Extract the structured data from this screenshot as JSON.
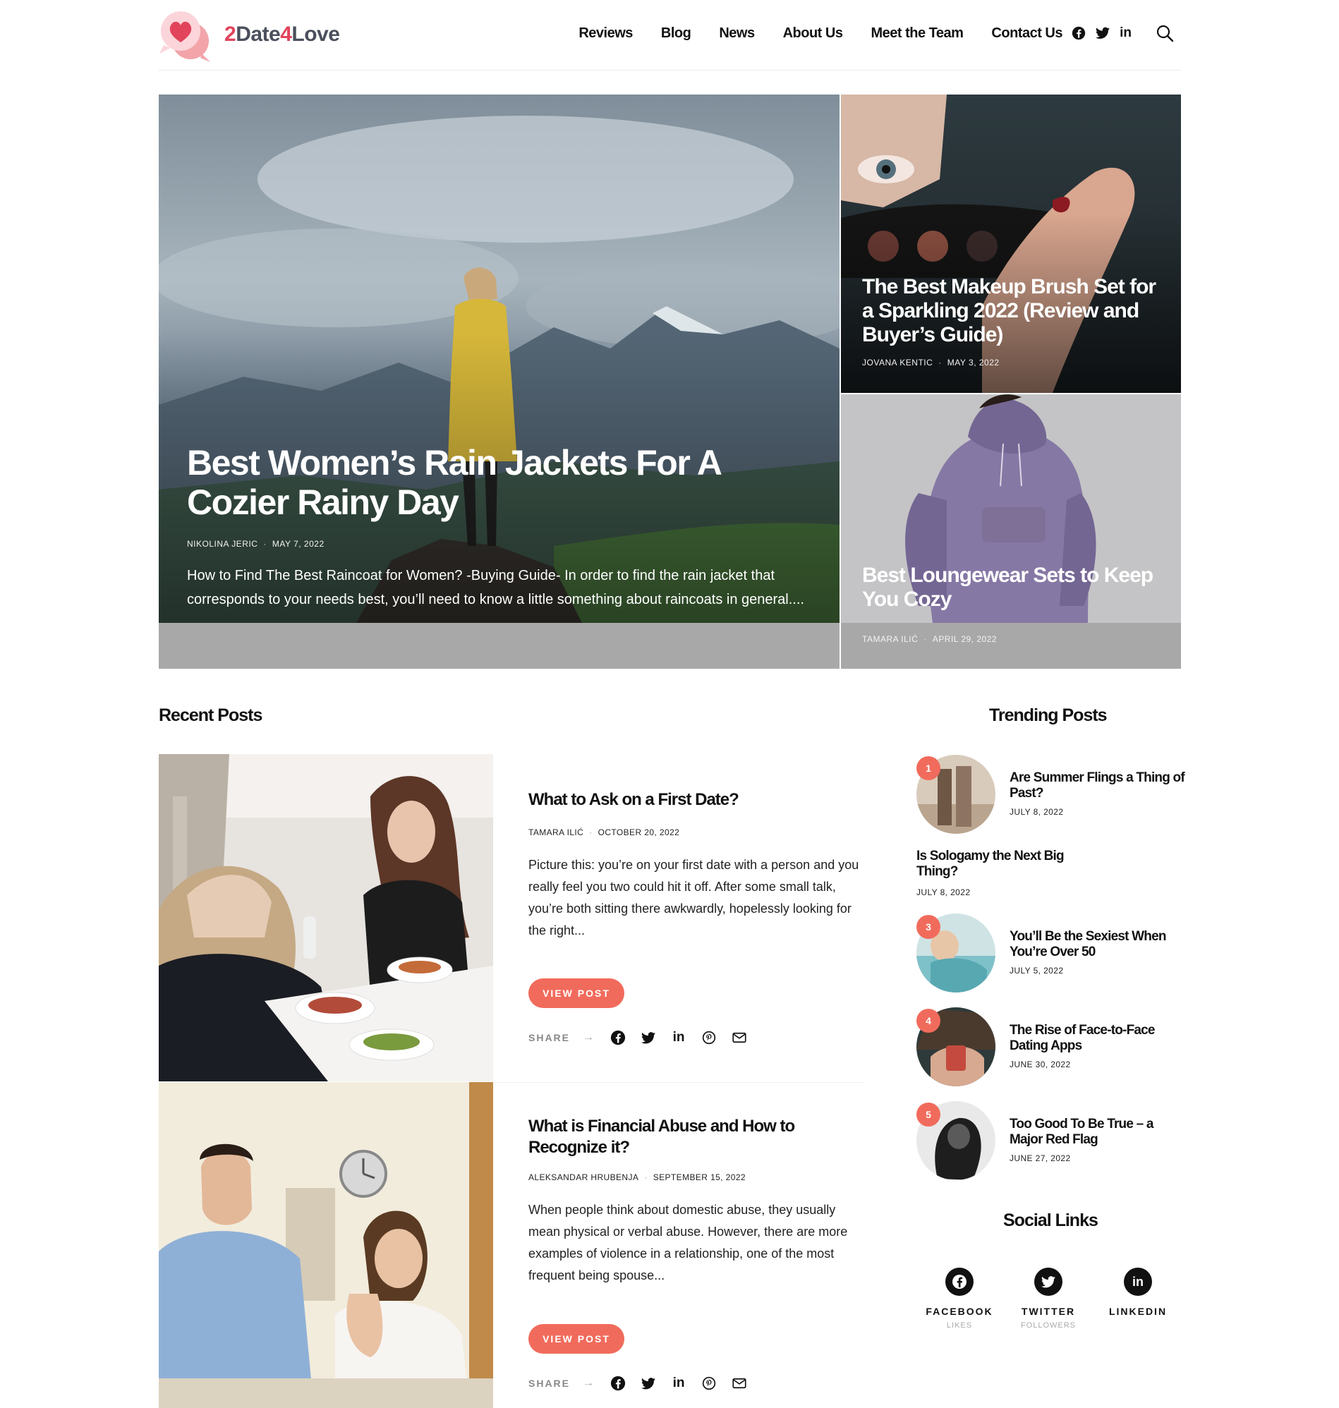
{
  "brand": {
    "part1": "2",
    "part2": "Date",
    "part3": "4",
    "part4": "Love",
    "color_primary": "#e2445c",
    "color_secondary": "#4b4f5c"
  },
  "nav": {
    "items": [
      "Reviews",
      "Blog",
      "News",
      "About Us",
      "Meet the Team",
      "Contact Us"
    ],
    "social_icons": [
      "facebook-icon",
      "twitter-icon",
      "linkedin-icon"
    ],
    "search_icon": "search-icon"
  },
  "hero": {
    "main": {
      "title": "Best Women’s Rain Jackets For A Cozier Rainy Day",
      "author": "NIKOLINA JERIC",
      "date": "MAY 7, 2022",
      "excerpt": "How to Find The Best Raincoat for Women? -Buying Guide- In order to find the rain jacket that corresponds to your needs best, you’ll need to know a little something about raincoats in general...."
    },
    "right_top": {
      "title": "The Best Makeup Brush Set for a Sparkling 2022 (Review and Buyer’s Guide)",
      "author": "JOVANA KENTIC",
      "date": "MAY 3, 2022"
    },
    "right_bottom": {
      "title": "Best Loungewear Sets to Keep You Cozy",
      "author": "TAMARA ILIĆ",
      "date": "APRIL 29, 2022"
    }
  },
  "recent": {
    "title": "Recent Posts",
    "posts": [
      {
        "title": "What to Ask on a First Date?",
        "author": "TAMARA ILIĆ",
        "date": "OCTOBER 20, 2022",
        "excerpt": "Picture this: you’re on your first date with a person and you really feel you two could hit it off. After some small talk, you’re both sitting there awkwardly, hopelessly looking for the right...",
        "button": "VIEW POST",
        "share": "SHARE"
      },
      {
        "title": "What is Financial Abuse and How to Recognize it?",
        "author": "ALEKSANDAR HRUBENJA",
        "date": "SEPTEMBER 15, 2022",
        "excerpt": "When people think about domestic abuse, they usually mean physical or verbal abuse. However, there are more examples of violence in a relationship, one of the most frequent being spouse...",
        "button": "VIEW POST",
        "share": "SHARE"
      }
    ]
  },
  "trending": {
    "title": "Trending Posts",
    "items": [
      {
        "num": "1",
        "title": "Are Summer Flings a Thing of Past?",
        "date": "JULY 8, 2022"
      },
      {
        "num": "",
        "title": "Is Sologamy the Next Big Thing?",
        "date": "JULY 8, 2022"
      },
      {
        "num": "3",
        "title": "You’ll Be the Sexiest When You’re Over 50",
        "date": "JULY 5, 2022"
      },
      {
        "num": "4",
        "title": "The Rise of Face-to-Face Dating Apps",
        "date": "JUNE 30, 2022"
      },
      {
        "num": "5",
        "title": "Too Good To Be True – a Major Red Flag",
        "date": "JUNE 27, 2022"
      }
    ]
  },
  "social": {
    "title": "Social Links",
    "items": [
      {
        "name": "FACEBOOK",
        "sub": "LIKES"
      },
      {
        "name": "TWITTER",
        "sub": "FOLLOWERS"
      },
      {
        "name": "LINKEDIN",
        "sub": ""
      }
    ]
  },
  "colors": {
    "accent": "#f16b5c"
  }
}
